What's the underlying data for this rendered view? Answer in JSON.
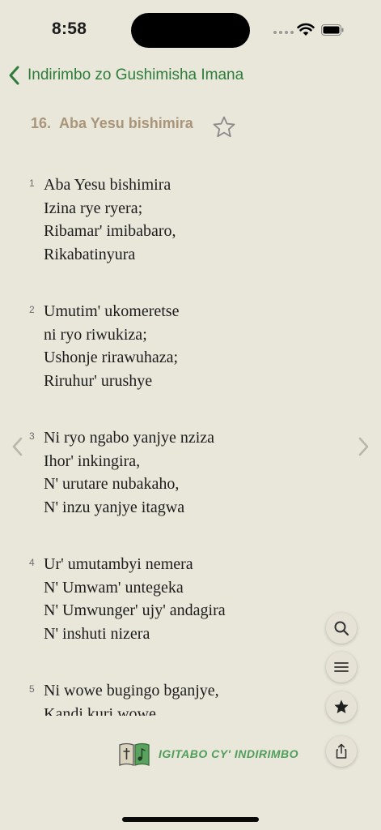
{
  "status_bar": {
    "time": "8:58"
  },
  "nav": {
    "back_label": "Indirimbo zo Gushimisha Imana"
  },
  "song": {
    "number": "16.",
    "title": "Aba Yesu bishimira"
  },
  "verses": [
    {
      "num": "1",
      "lines": [
        "Aba Yesu bishimira",
        "Izina rye ryera;",
        "Ribamar' imibabaro,",
        "Rikabatinyura"
      ]
    },
    {
      "num": "2",
      "lines": [
        "Umutim' ukomeretse",
        "ni ryo riwukiza;",
        "Ushonje rirawuhaza;",
        "Riruhur' urushye"
      ]
    },
    {
      "num": "3",
      "lines": [
        "Ni ryo ngabo yanjye nziza",
        "Ihor' inkingira,",
        "N' urutare nubakaho,",
        "N' inzu yanjye itagwa"
      ]
    },
    {
      "num": "4",
      "lines": [
        "Ur' umutambyi nemera",
        "N' Umwam' untegeka",
        "N' Umwunger' ujy' andagira",
        "N' inshuti nizera"
      ]
    },
    {
      "num": "5",
      "lines": [
        "Ni wowe bugingo bganjye,",
        "Kandi kuri wowe"
      ]
    }
  ],
  "footer": {
    "brand": "IGITABO CY' INDIRIMBO"
  },
  "icons": {
    "back": "chevron-left-icon",
    "favorite": "star-outline-icon",
    "prev": "chevron-left-icon",
    "next": "chevron-right-icon",
    "search": "magnifier-icon",
    "menu": "list-icon",
    "favorites": "star-filled-icon",
    "share": "share-icon"
  },
  "colors": {
    "accent": "#2e7d3a",
    "title": "#a99579",
    "background": "#e9e6da",
    "brand": "#4f9e5a"
  }
}
